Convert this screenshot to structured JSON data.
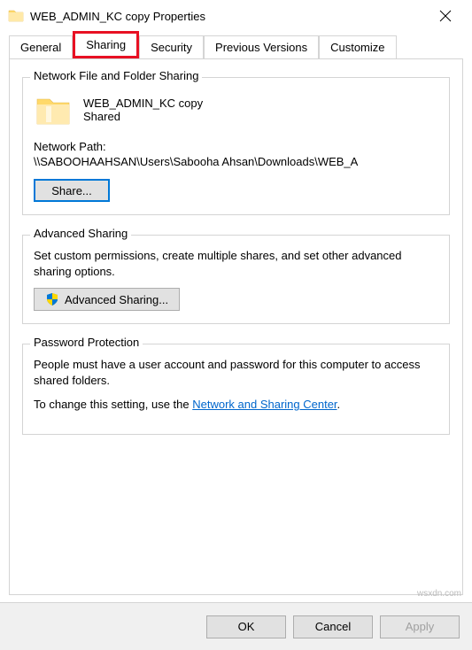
{
  "window": {
    "title": "WEB_ADMIN_KC copy Properties"
  },
  "tabs": {
    "general": "General",
    "sharing": "Sharing",
    "security": "Security",
    "previous": "Previous Versions",
    "customize": "Customize"
  },
  "network_sharing": {
    "title": "Network File and Folder Sharing",
    "folder_name": "WEB_ADMIN_KC copy",
    "status": "Shared",
    "path_label": "Network Path:",
    "path_value": "\\\\SABOOHAAHSAN\\Users\\Sabooha Ahsan\\Downloads\\WEB_A",
    "share_button": "Share..."
  },
  "advanced_sharing": {
    "title": "Advanced Sharing",
    "text": "Set custom permissions, create multiple shares, and set other advanced sharing options.",
    "button": "Advanced Sharing..."
  },
  "password_protection": {
    "title": "Password Protection",
    "text": "People must have a user account and password for this computer to access shared folders.",
    "change_text": "To change this setting, use the ",
    "link_text": "Network and Sharing Center",
    "period": "."
  },
  "footer": {
    "ok": "OK",
    "cancel": "Cancel",
    "apply": "Apply"
  },
  "watermark": "wsxdn.com"
}
